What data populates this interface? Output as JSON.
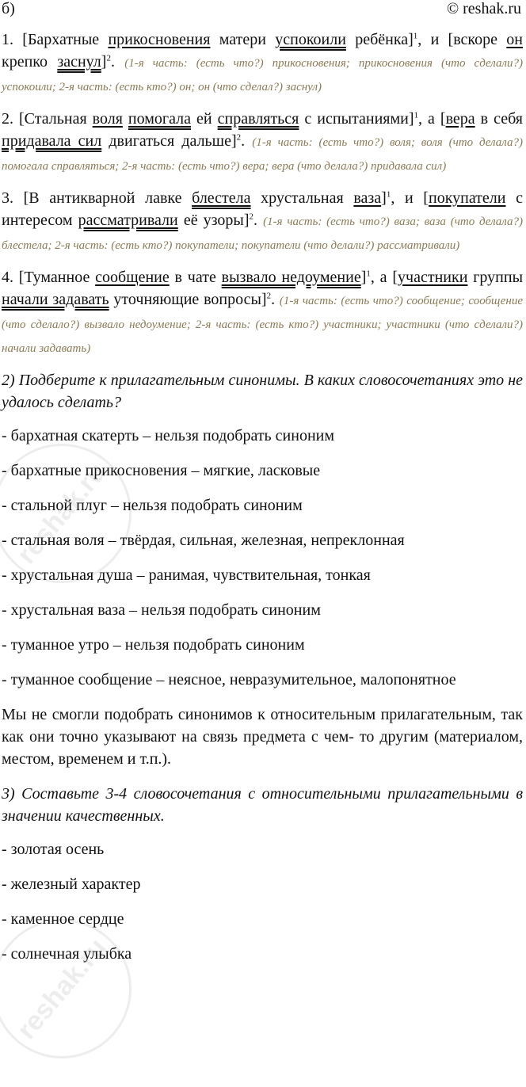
{
  "header": {
    "label": "б)",
    "copyright": "© reshak.ru"
  },
  "watermark": {
    "text": "reshak.ru"
  },
  "sentences": [
    [
      {
        "t": "1. [Бархатные "
      },
      {
        "t": "прикосновения",
        "u": "s"
      },
      {
        "t": " матери "
      },
      {
        "t": "успокоили",
        "u": "p"
      },
      {
        "t": " ребёнка]"
      },
      {
        "t": "1",
        "sup": true
      },
      {
        "t": ", и [вскоре "
      },
      {
        "t": "он",
        "u": "s"
      },
      {
        "t": " крепко "
      },
      {
        "t": "заснул",
        "u": "p"
      },
      {
        "t": "]"
      },
      {
        "t": "2",
        "sup": true
      },
      {
        "t": ". "
      },
      {
        "t": "(1-я часть: (есть что?) прикосновения; прикосновения (что сделали?) успокоили; 2-я часть: (есть кто?) он; он (что сделал?) заснул)",
        "note": true
      }
    ],
    [
      {
        "t": "2. [Стальная "
      },
      {
        "t": "воля",
        "u": "s"
      },
      {
        "t": " "
      },
      {
        "t": "помогала",
        "u": "p"
      },
      {
        "t": " ей "
      },
      {
        "t": "справляться",
        "u": "p"
      },
      {
        "t": " с испытаниями]"
      },
      {
        "t": "1",
        "sup": true
      },
      {
        "t": ", а ["
      },
      {
        "t": "вера",
        "u": "s"
      },
      {
        "t": " в себя "
      },
      {
        "t": "придавала сил",
        "u": "p"
      },
      {
        "t": " двигаться дальше]"
      },
      {
        "t": "2",
        "sup": true
      },
      {
        "t": ". "
      },
      {
        "t": "(1-я часть: (есть что?) воля; воля (что делала?) помогала справляться; 2-я часть: (есть что?) вера; вера (что делала?) придавала сил)",
        "note": true
      }
    ],
    [
      {
        "t": "3. [В антикварной лавке "
      },
      {
        "t": "блестела",
        "u": "p"
      },
      {
        "t": " хрустальная "
      },
      {
        "t": "ваза",
        "u": "s"
      },
      {
        "t": "]"
      },
      {
        "t": "1",
        "sup": true
      },
      {
        "t": ", и ["
      },
      {
        "t": "покупатели",
        "u": "s"
      },
      {
        "t": " с интересом "
      },
      {
        "t": "рассматривали",
        "u": "p"
      },
      {
        "t": " её узоры]"
      },
      {
        "t": "2",
        "sup": true
      },
      {
        "t": ". "
      },
      {
        "t": "(1-я часть: (есть что?) ваза; ваза (что делала?) блестела; 2-я часть: (есть кто?) покупатели; покупатели (что делали?) рассматривали)",
        "note": true
      }
    ],
    [
      {
        "t": "4. [Туманное "
      },
      {
        "t": "сообщение",
        "u": "s"
      },
      {
        "t": " в чате "
      },
      {
        "t": "вызвало недоумение",
        "u": "p"
      },
      {
        "t": "]"
      },
      {
        "t": "1",
        "sup": true
      },
      {
        "t": ", а ["
      },
      {
        "t": "участники",
        "u": "s"
      },
      {
        "t": " группы "
      },
      {
        "t": "начали задавать",
        "u": "p"
      },
      {
        "t": " уточняющие вопросы]"
      },
      {
        "t": "2",
        "sup": true
      },
      {
        "t": ". "
      },
      {
        "t": "(1-я часть: (есть что?) сообщение; сообщение (что сделало?) вызвало недоумение; 2-я часть: (есть кто?) участники; участники (что сделали?) начали задавать)",
        "note": true
      }
    ]
  ],
  "question2": "2) Подберите к прилагательным синонимы. В каких словосочетаниях это не удалось сделать?",
  "synonyms": [
    "- бархатная скатерть – нельзя подобрать синоним",
    "- бархатные прикосновения – мягкие, ласковые",
    "- стальной плуг – нельзя подобрать синоним",
    "- стальная воля – твёрдая, сильная, железная, непреклонная",
    "- хрустальная душа – ранимая, чувствительная, тонкая",
    "- хрустальная ваза – нельзя подобрать синоним",
    "- туманное утро – нельзя подобрать синоним",
    "- туманное сообщение – неясное, невразумительное, малопонятное"
  ],
  "conclusion": "Мы не смогли подобрать синонимов к относительным прилагательным, так как они точно указывают на связь предмета с чем- то другим (материалом, местом, временем и т.п.).",
  "question3": "3) Составьте 3-4 словосочетания с относительными прилагательными в значении качественных.",
  "phrases": [
    "- золотая осень",
    "- железный характер",
    "- каменное сердце",
    "- солнечная улыбка"
  ]
}
